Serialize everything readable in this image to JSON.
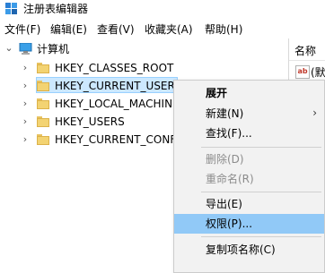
{
  "window": {
    "title": "注册表编辑器",
    "icon": "registry-editor-icon"
  },
  "menubar": {
    "items": [
      {
        "label": "文件(F)"
      },
      {
        "label": "编辑(E)"
      },
      {
        "label": "查看(V)"
      },
      {
        "label": "收藏夹(A)"
      },
      {
        "label": "帮助(H)"
      }
    ]
  },
  "tree": {
    "root": {
      "label": "计算机",
      "expanded": true,
      "icon": "computer-icon"
    },
    "children": [
      {
        "label": "HKEY_CLASSES_ROOT",
        "icon": "folder-icon",
        "selected": false
      },
      {
        "label": "HKEY_CURRENT_USER",
        "icon": "folder-icon",
        "selected": true
      },
      {
        "label": "HKEY_LOCAL_MACHINE",
        "icon": "folder-icon",
        "selected": false
      },
      {
        "label": "HKEY_USERS",
        "icon": "folder-icon",
        "selected": false
      },
      {
        "label": "HKEY_CURRENT_CONFIG",
        "icon": "folder-icon",
        "selected": false
      }
    ]
  },
  "values_pane": {
    "column_name": "名称",
    "rows": [
      {
        "name": "(默认)",
        "icon": "ab-string-icon"
      }
    ]
  },
  "context_menu": {
    "items": [
      {
        "label": "展开",
        "bold": true
      },
      {
        "label": "新建(N)",
        "submenu": true
      },
      {
        "label": "查找(F)..."
      },
      {
        "label": "删除(D)",
        "disabled": true
      },
      {
        "label": "重命名(R)",
        "disabled": true
      },
      {
        "label": "导出(E)"
      },
      {
        "label": "权限(P)...",
        "highlighted": true
      },
      {
        "label": "复制项名称(C)"
      }
    ]
  },
  "colors": {
    "selection_bg": "#cce8ff",
    "menu_highlight": "#91c9f7",
    "menu_bg": "#f2f2f2",
    "folder": "#f3d372"
  }
}
